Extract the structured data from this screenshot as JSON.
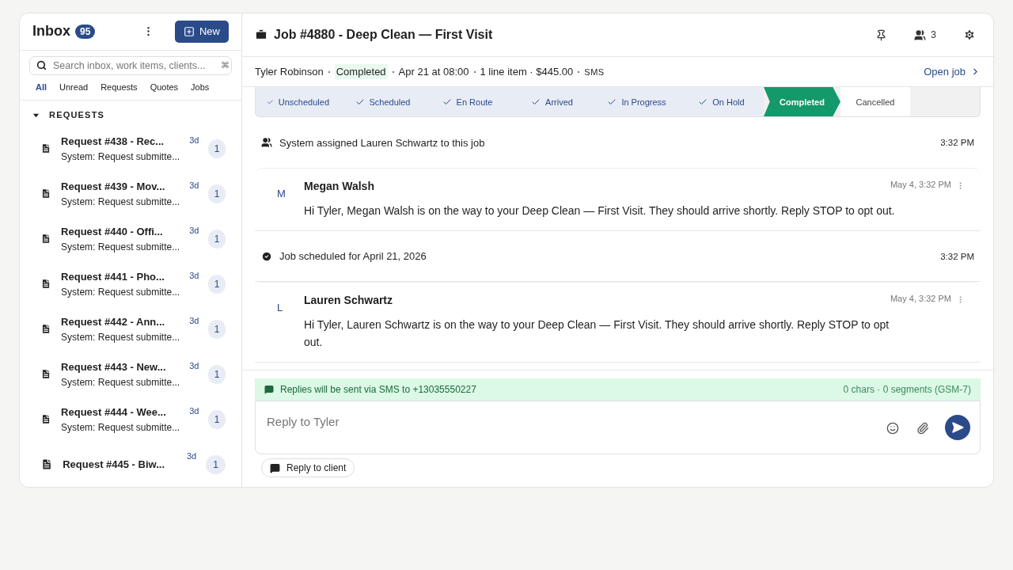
{
  "sidebar": {
    "title": "Inbox",
    "unread_count": "95",
    "new_button": "New",
    "search": {
      "placeholder": "Search inbox, work items, clients...",
      "shortcut": "⌘"
    },
    "filters": [
      {
        "label": "All",
        "selected": true
      },
      {
        "label": "Unread",
        "selected": false
      },
      {
        "label": "Requests",
        "selected": false
      },
      {
        "label": "Quotes",
        "selected": false
      },
      {
        "label": "Jobs",
        "selected": false
      }
    ],
    "section": {
      "title": "REQUESTS",
      "expanded": true
    },
    "items": [
      {
        "title": "Request #438 - Rec...",
        "subtitle": "System: Request submitte...",
        "age": "3d",
        "count": "1"
      },
      {
        "title": "Request #439 - Mov...",
        "subtitle": "System: Request submitte...",
        "age": "3d",
        "count": "1"
      },
      {
        "title": "Request #440 - Offi...",
        "subtitle": "System: Request submitte...",
        "age": "3d",
        "count": "1"
      },
      {
        "title": "Request #441 - Pho...",
        "subtitle": "System: Request submitte...",
        "age": "3d",
        "count": "1"
      },
      {
        "title": "Request #442 - Ann...",
        "subtitle": "System: Request submitte...",
        "age": "3d",
        "count": "1"
      },
      {
        "title": "Request #443 - New...",
        "subtitle": "System: Request submitte...",
        "age": "3d",
        "count": "1"
      },
      {
        "title": "Request #444 - Wee...",
        "subtitle": "System: Request submitte...",
        "age": "3d",
        "count": "1"
      },
      {
        "title": "Request #445 - Biw...",
        "age": "3d",
        "count": "1"
      }
    ]
  },
  "job": {
    "title": "Job #4880 - Deep Clean — First Visit",
    "members_count": "3",
    "client": "Tyler Robinson",
    "status": "Completed",
    "meta": [
      "Apr 21 at 08:00",
      "1 line item · $445.00"
    ],
    "channel": "SMS",
    "open_link": "Open job",
    "stages": [
      {
        "label": "Unscheduled",
        "done": true,
        "selected": false
      },
      {
        "label": "Scheduled",
        "done": true,
        "selected": false
      },
      {
        "label": "En Route",
        "done": true,
        "selected": false
      },
      {
        "label": "Arrived",
        "done": true,
        "selected": false
      },
      {
        "label": "In Progress",
        "done": true,
        "selected": false
      },
      {
        "label": "On Hold",
        "done": true,
        "selected": false
      },
      {
        "label": "Completed",
        "done": false,
        "selected": true
      },
      {
        "label": "Cancelled",
        "done": false,
        "selected": false
      }
    ]
  },
  "feed": [
    {
      "kind": "assigned",
      "text": "System assigned Lauren Schwartz to this job",
      "time": "3:32 PM"
    },
    {
      "kind": "message",
      "initial": "M",
      "sender": "Megan Walsh",
      "time": "May 4, 3:32 PM",
      "text": "Hi Tyler, Megan Walsh is on the way to your Deep Clean — First Visit. They should arrive shortly. Reply STOP to opt out."
    },
    {
      "kind": "scheduled",
      "text": "Job scheduled for April 21, 2026",
      "time": "3:32 PM"
    },
    {
      "kind": "message",
      "initial": "L",
      "sender": "Lauren Schwartz",
      "time": "May 4, 3:32 PM",
      "text": "Hi Tyler, Lauren Schwartz is on the way to your Deep Clean — First Visit. They should arrive shortly. Reply STOP to opt out."
    }
  ],
  "composer": {
    "notice": "Replies will be sent via SMS to +13035550227",
    "counter": "0 chars · 0 segments (GSM-7)",
    "placeholder": "Reply to Tyler",
    "mode_button": "Reply to client"
  }
}
